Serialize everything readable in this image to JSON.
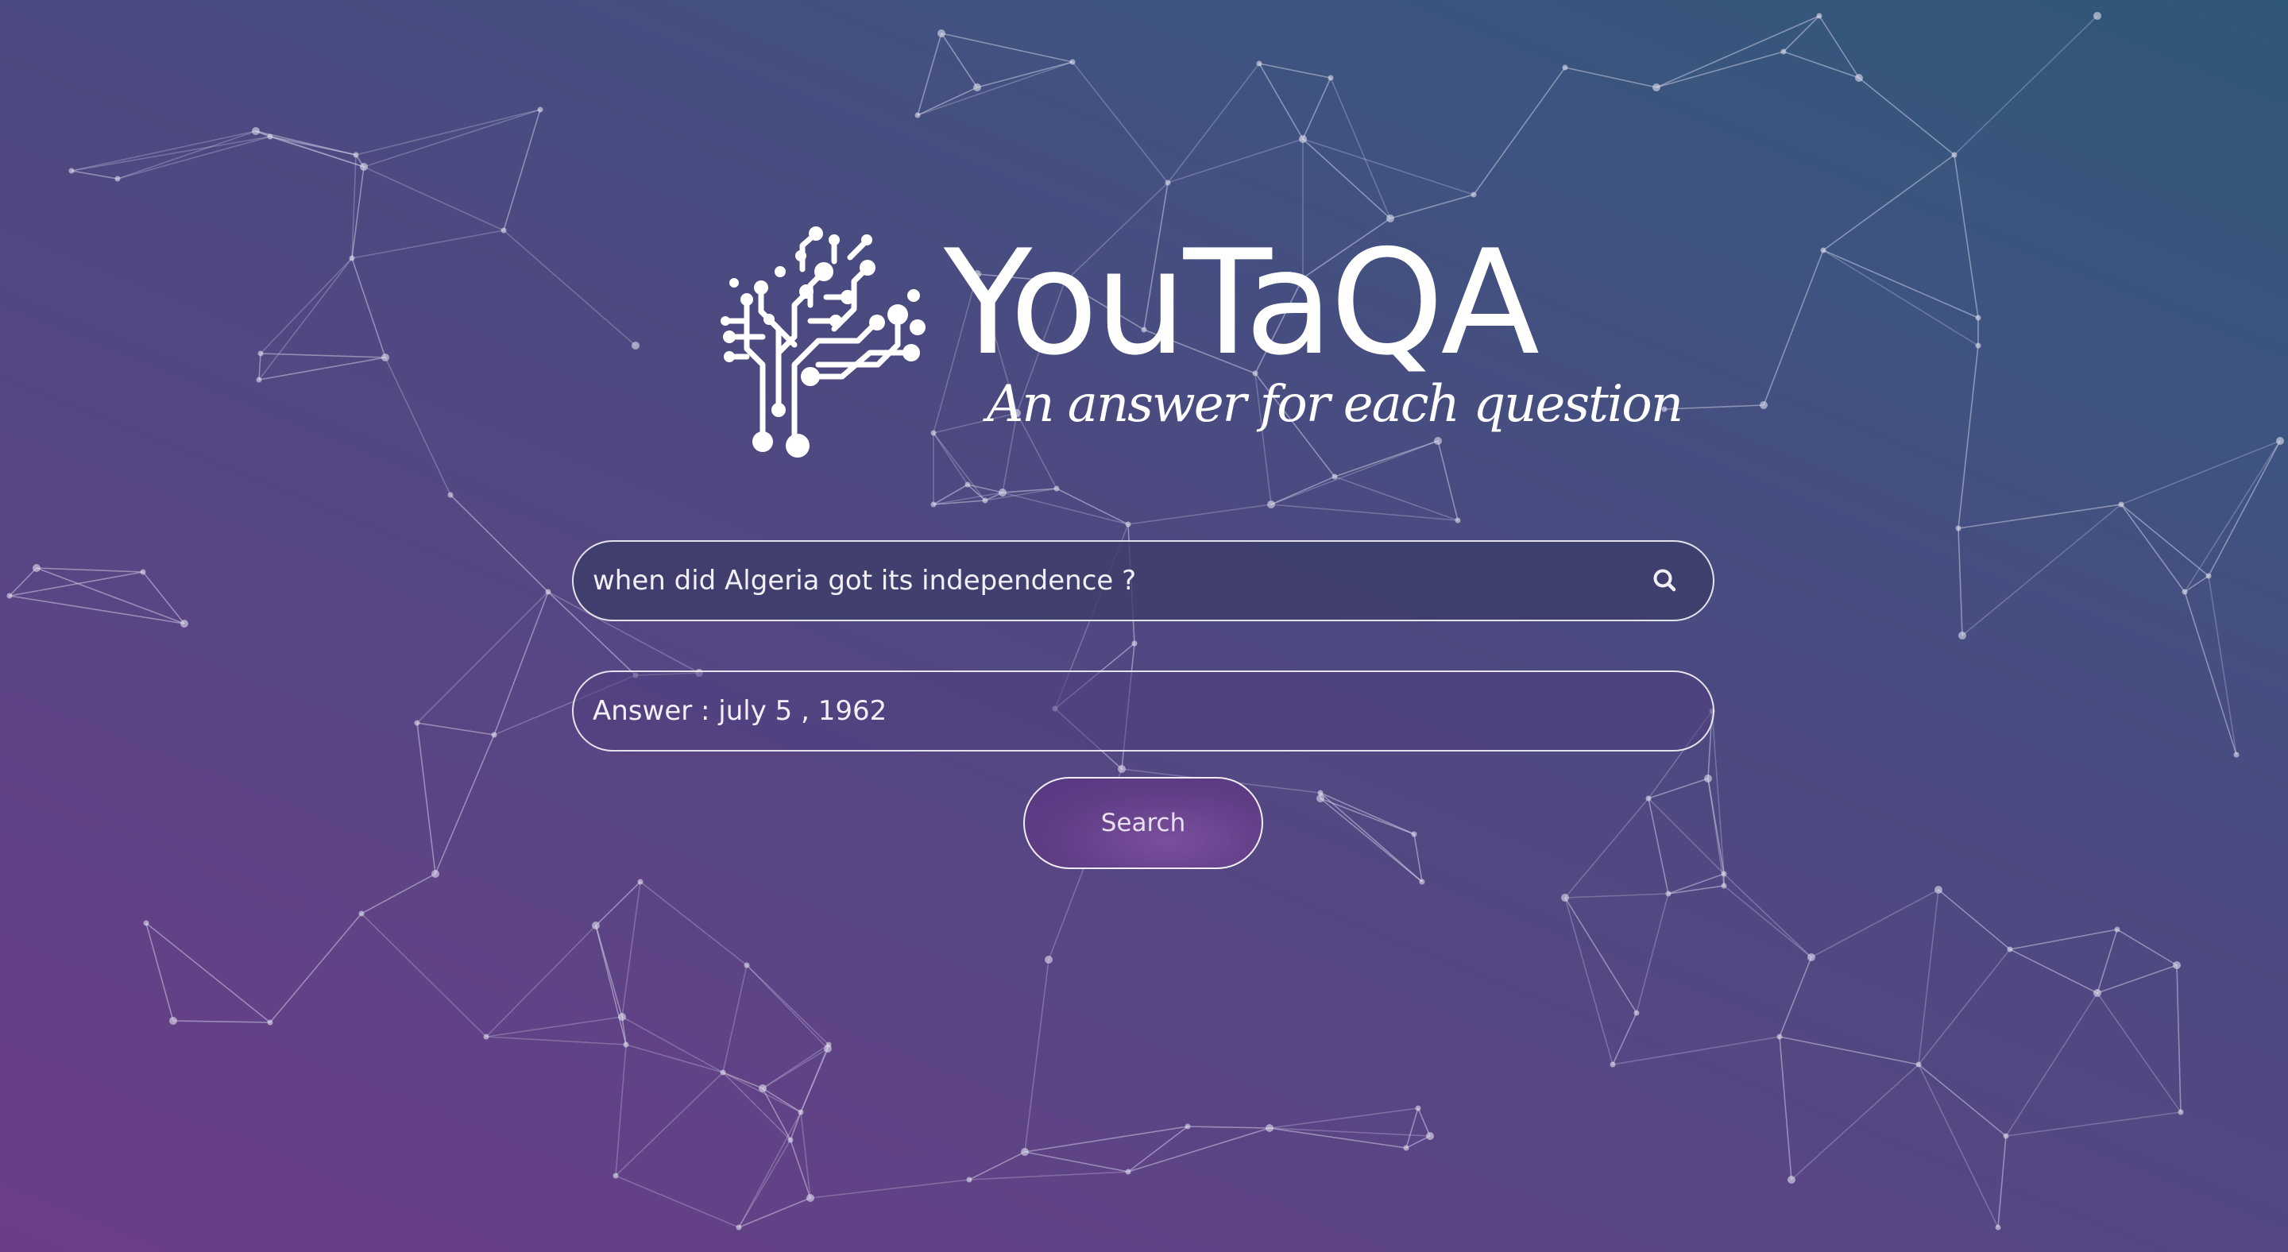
{
  "brand": {
    "name": "YouTaQA",
    "tagline": "An answer for each question"
  },
  "question": {
    "value": "when did Algeria got its independence ?",
    "placeholder": ""
  },
  "answer": {
    "text": "Answer : july 5 , 1962"
  },
  "search_button": {
    "label": "Search"
  },
  "icons": {
    "search": "search-icon",
    "logo": "circuit-tree-icon"
  },
  "colors": {
    "background_start": "#6b3d88",
    "background_end": "#2f5778",
    "text": "#ffffff",
    "button_fill": "#603e86"
  }
}
